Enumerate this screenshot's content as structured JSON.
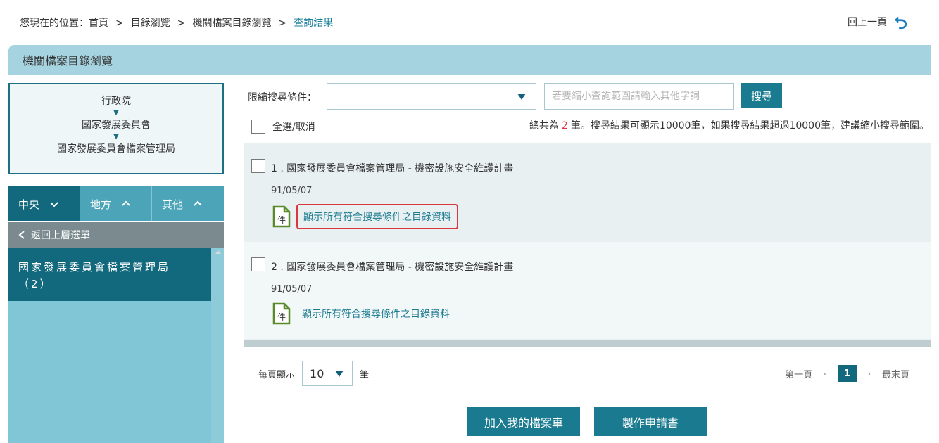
{
  "breadcrumb": {
    "prefix": "您現在的位置：",
    "items": [
      "首頁",
      "目錄瀏覽",
      "機關檔案目錄瀏覽"
    ],
    "separator": ">",
    "current": "查詢結果"
  },
  "back_link": "回上一頁",
  "page_title": "機關檔案目錄瀏覽",
  "org_path": [
    "行政院",
    "國家發展委員會",
    "國家發展委員會檔案管理局"
  ],
  "org_arrow": "▼",
  "tabs": [
    {
      "label": "中央",
      "state": "down"
    },
    {
      "label": "地方",
      "state": "up"
    },
    {
      "label": "其他",
      "state": "up"
    }
  ],
  "back_menu": "返回上層選單",
  "side_items": [
    {
      "name": "國家發展委員會檔案管理局",
      "count": "（2）"
    }
  ],
  "filter": {
    "label": "限縮搜尋條件：",
    "select_value": "",
    "placeholder": "若要縮小查詢範圍請輸入其他字詞",
    "search_label": "搜尋"
  },
  "select_all": "全選/取消",
  "summary": {
    "before": "總共為",
    "count": "2",
    "after": "筆。搜尋結果可顯示10000筆，如果搜尋結果超過10000筆，建議縮小搜尋範圍。"
  },
  "results": [
    {
      "title": "1 . 國家發展委員會檔案管理局 - 機密設施安全維護計畫",
      "date": "91/05/07",
      "icon_text": "件",
      "link": "顯示所有符合搜尋條件之目錄資料"
    },
    {
      "title": "2 . 國家發展委員會檔案管理局 - 機密設施安全維護計畫",
      "date": "91/05/07",
      "icon_text": "件",
      "link": "顯示所有符合搜尋條件之目錄資料"
    }
  ],
  "per_page": {
    "label": "每頁顯示",
    "value": "10",
    "unit": "筆"
  },
  "pager": {
    "first": "第一頁",
    "prev": "‹",
    "current": "1",
    "next": "›",
    "last": "最末頁"
  },
  "buttons": {
    "add_cart": "加入我的檔案車",
    "make_request": "製作申請書"
  },
  "colors": {
    "primary": "#1a7a8f",
    "dark_teal": "#12687d",
    "header": "#a5d3e0",
    "highlight": "#d9363e"
  }
}
